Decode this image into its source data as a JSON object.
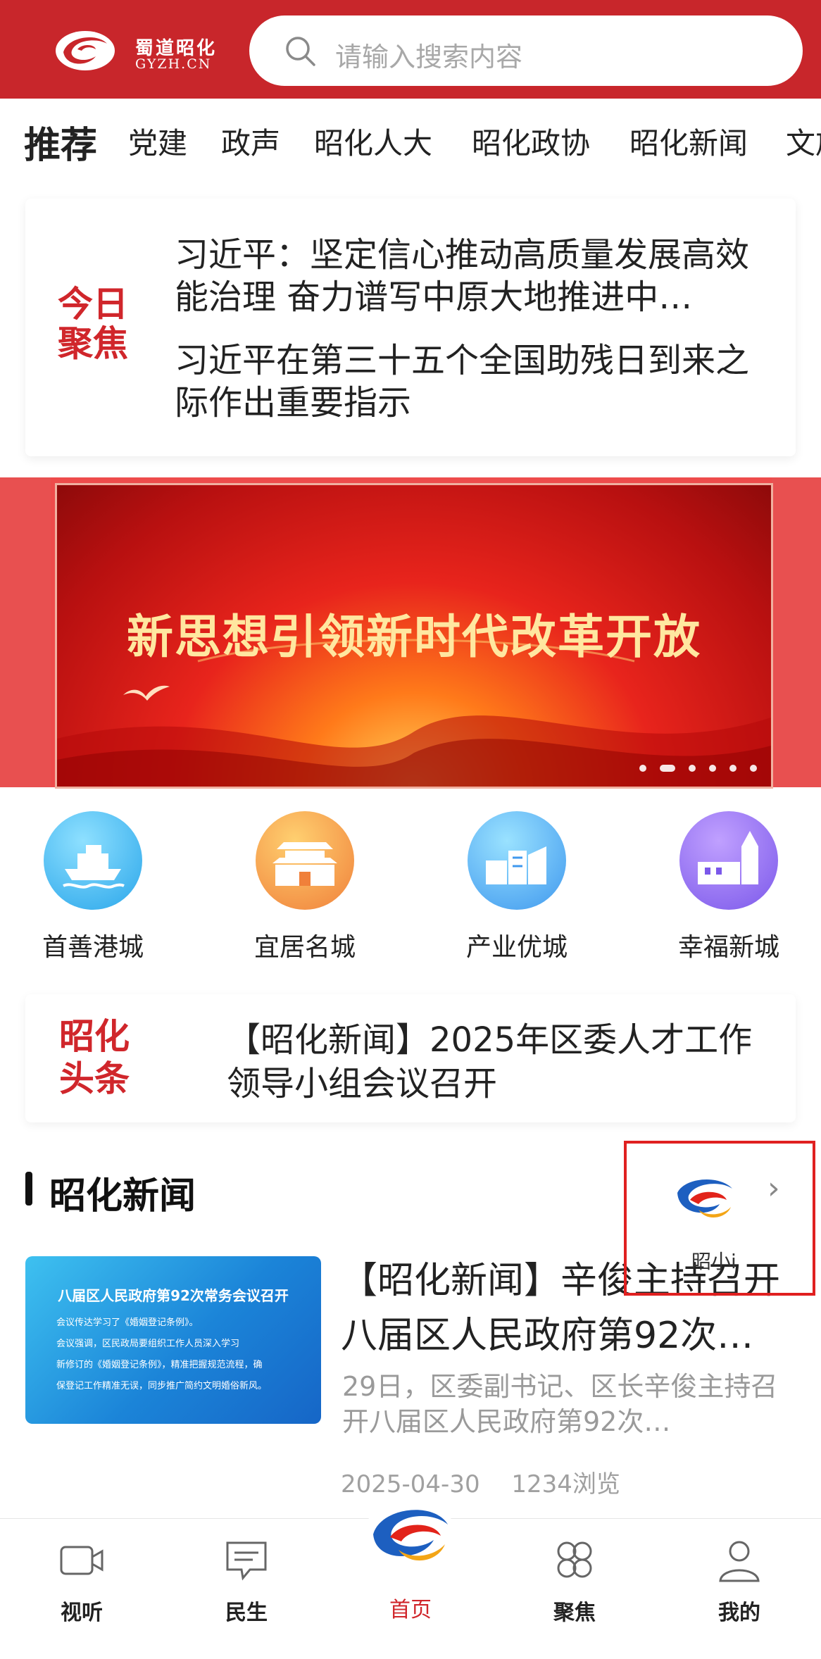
{
  "header": {
    "brand_cn": "蜀道昭化",
    "brand_en": "GYZH.CN",
    "search_placeholder": "请输入搜索内容"
  },
  "tabs": [
    "推荐",
    "党建",
    "政声",
    "昭化人大",
    "昭化政协",
    "昭化新闻",
    "文旅"
  ],
  "focus": {
    "label": "今日聚焦",
    "items": [
      "习近平：坚定信心推动高质量发展高效能治理 奋力谱写中原大地推进中…",
      "习近平在第三十五个全国助残日到来之际作出重要指示"
    ]
  },
  "banner": {
    "text": "新思想引领新时代改革开放",
    "slide_count": 6,
    "active_slide": 2
  },
  "icon_grid": [
    {
      "label": "首善港城",
      "icon": "ship-icon",
      "color": "#3ab4ee"
    },
    {
      "label": "宜居名城",
      "icon": "gate-tower-icon",
      "color": "#f59a3c"
    },
    {
      "label": "产业优城",
      "icon": "factory-icon",
      "color": "#4aa8f0"
    },
    {
      "label": "幸福新城",
      "icon": "church-icon",
      "color": "#8a68ee"
    }
  ],
  "headline": {
    "label": "昭化头条",
    "text": "【昭化新闻】2025年区委人才工作领导小组会议召开"
  },
  "news_section": {
    "title": "昭化新闻",
    "assistant_label": "昭小i"
  },
  "news_item": {
    "thumb_title": "八届区人民政府第92次常务会议召开",
    "thumb_lines": [
      "会议传达学习了《婚姻登记条例》。",
      "会议强调，区民政局要组织工作人员深入学习",
      "新修订的《婚姻登记条例》，精准把握规范流程，确",
      "保登记工作精准无误，同步推广简约文明婚俗新风。"
    ],
    "title": "【昭化新闻】辛俊主持召开八届区人民政府第92次…",
    "summary": "29日，区委副书记、区长辛俊主持召开八届区人民政府第92次…",
    "date": "2025-04-30",
    "views": "1234浏览"
  },
  "bottom_nav": [
    {
      "label": "视听",
      "icon": "video-icon"
    },
    {
      "label": "民生",
      "icon": "chat-icon"
    },
    {
      "label": "首页",
      "icon": "home-logo-icon",
      "active": true
    },
    {
      "label": "聚焦",
      "icon": "grid-icon"
    },
    {
      "label": "我的",
      "icon": "user-icon"
    }
  ],
  "colors": {
    "brand_red": "#c8262b",
    "accent_red": "#d0262b"
  }
}
